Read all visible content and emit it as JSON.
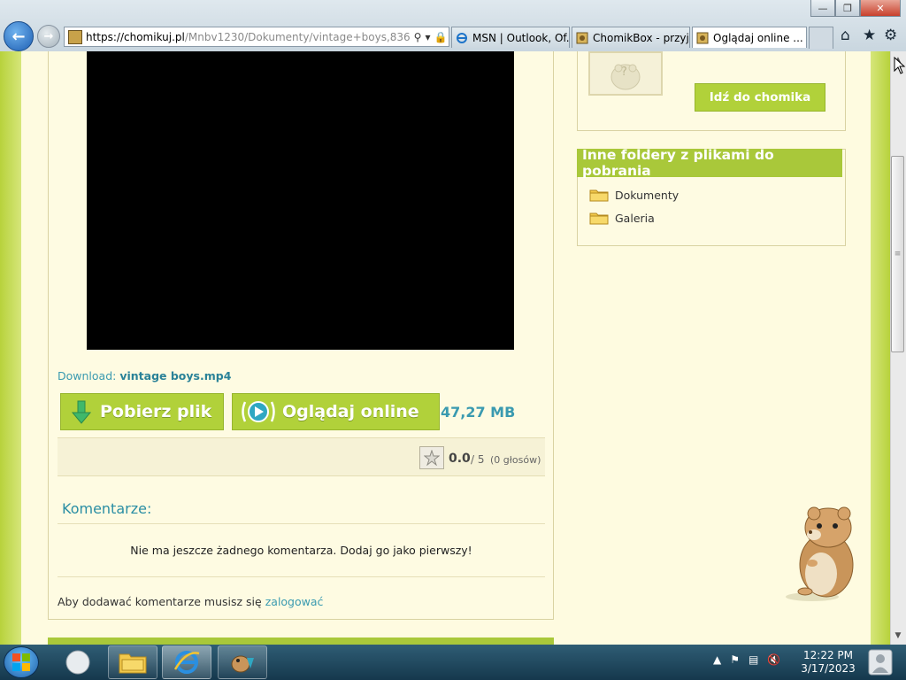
{
  "browser": {
    "address": {
      "host": "https://chomikuj.pl",
      "path": "/Mnbv1230/Dokumenty/vintage+boys,836"
    },
    "tabs": [
      {
        "label": "MSN | Outlook, Of...",
        "icon": "ie-icon"
      },
      {
        "label": "ChomikBox - przyj...",
        "icon": "chomik-icon"
      },
      {
        "label": "Oglądaj online ...",
        "icon": "chomik-icon",
        "active": true
      }
    ],
    "window_buttons": [
      "minimize",
      "maximize",
      "close"
    ]
  },
  "page": {
    "download_prefix": "Download:",
    "download_filename": "vintage boys.mp4",
    "pobierz_label": "Pobierz plik",
    "ogladaj_label": "Oglądaj online",
    "file_size": "47,27 MB",
    "rating": {
      "score": "0.0",
      "max": "/ 5",
      "votes": "(0 głosów)"
    },
    "comments": {
      "heading": "Komentarze:",
      "empty_message": "Nie ma jeszcze żadnego komentarza. Dodaj go jako pierwszy!",
      "login_prefix": "Aby dodawać komentarze musisz się",
      "login_link": "zalogować"
    },
    "sidebar": {
      "avatar_mark": "?",
      "idz_button": "Idź do chomika",
      "folders_heading": "Inne foldery z plikami do pobrania",
      "folders": [
        "Dokumenty",
        "Galeria"
      ]
    }
  },
  "taskbar": {
    "clock_time": "12:22 PM",
    "clock_date": "3/17/2023"
  },
  "colors": {
    "accent_green": "#b1d13a",
    "link_teal": "#3a9ab0",
    "page_bg": "#fefbe0"
  }
}
